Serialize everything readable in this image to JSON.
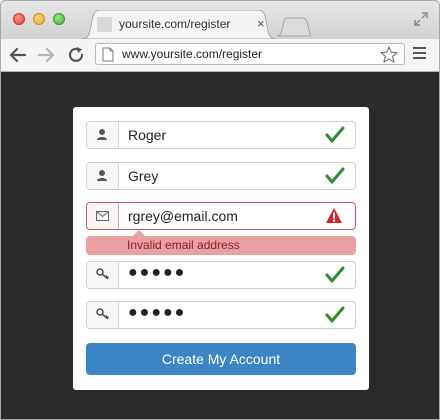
{
  "browser": {
    "tab_title": "yoursite.com/register",
    "tab_close": "×",
    "url": "www.yoursite.com/register"
  },
  "form": {
    "first_name": {
      "value": "Roger",
      "icon": "user-icon",
      "status": "valid"
    },
    "last_name": {
      "value": "Grey",
      "icon": "user-icon",
      "status": "valid"
    },
    "email": {
      "value": "rgrey@email.com",
      "icon": "envelope-icon",
      "status": "error",
      "error_message": "Invalid email address"
    },
    "password": {
      "value": "●●●●●",
      "icon": "key-icon",
      "status": "valid"
    },
    "password_confirm": {
      "value": "●●●●●",
      "icon": "key-icon",
      "status": "valid"
    },
    "submit_label": "Create My Account"
  },
  "colors": {
    "accent": "#3d86c6",
    "valid": "#2e8b2e",
    "error": "#d2252f",
    "error_bg": "#eca0a4",
    "page_bg": "#2b2b2b"
  }
}
